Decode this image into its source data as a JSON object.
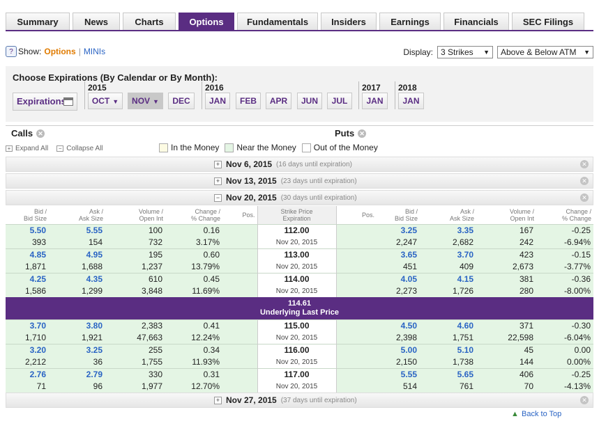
{
  "tabs": [
    {
      "label": "Summary",
      "w": 92
    },
    {
      "label": "News",
      "w": 68
    },
    {
      "label": "Charts",
      "w": 76
    },
    {
      "label": "Options",
      "w": 80,
      "active": true
    },
    {
      "label": "Fundamentals",
      "w": 116
    },
    {
      "label": "Insiders",
      "w": 80
    },
    {
      "label": "Earnings",
      "w": 88
    },
    {
      "label": "Financials",
      "w": 94
    },
    {
      "label": "SEC Filings",
      "w": 104
    }
  ],
  "show": {
    "label": "Show:",
    "selected": "Options",
    "other": "MINIs",
    "help": "?"
  },
  "display": {
    "label": "Display:",
    "strikes": "3 Strikes",
    "range": "Above & Below ATM"
  },
  "expirations": {
    "title": "Choose Expirations (By Calendar or By Month):",
    "button": "Expirations",
    "years": [
      "2015",
      "2016",
      "2017",
      "2018"
    ],
    "months_2015": [
      "OCT",
      "NOV",
      "DEC"
    ],
    "months_2016": [
      "JAN",
      "FEB",
      "APR",
      "JUN",
      "JUL"
    ],
    "months_2017": [
      "JAN"
    ],
    "months_2018": [
      "JAN"
    ]
  },
  "calls_label": "Calls",
  "puts_label": "Puts",
  "expand_all": "Expand All",
  "collapse_all": "Collapse All",
  "legend": [
    {
      "label": "In the Money",
      "color": "#fdfbe3"
    },
    {
      "label": "Near the Money",
      "color": "#e4f5e4"
    },
    {
      "label": "Out of the Money",
      "color": "#ffffff"
    }
  ],
  "expiration_bars": [
    {
      "date": "Nov 6, 2015",
      "until": "(16 days until expiration)",
      "state": "+"
    },
    {
      "date": "Nov 13, 2015",
      "until": "(23 days until expiration)",
      "state": "+"
    },
    {
      "date": "Nov 20, 2015",
      "until": "(30 days until expiration)",
      "state": "−"
    },
    {
      "date": "Nov 27, 2015",
      "until": "(37 days until expiration)",
      "state": "+"
    }
  ],
  "columns": {
    "call_bid": [
      "Bid /",
      "Bid Size"
    ],
    "call_ask": [
      "Ask /",
      "Ask Size"
    ],
    "call_vol": [
      "Volume /",
      "Open Int"
    ],
    "call_chg": [
      "Change /",
      "% Change"
    ],
    "call_pos": "Pos.",
    "strike": [
      "Strike Price",
      "Expiration"
    ],
    "put_pos": "Pos.",
    "put_bid": [
      "Bid /",
      "Bid Size"
    ],
    "put_ask": [
      "Ask /",
      "Ask Size"
    ],
    "put_vol": [
      "Volume /",
      "Open Int"
    ],
    "put_chg": [
      "Change /",
      "% Change"
    ]
  },
  "rows_above": [
    {
      "cb": "5.50",
      "cbs": "393",
      "ca": "5.55",
      "cas": "154",
      "cv": "100",
      "coi": "732",
      "cc": "0.16",
      "cpc": "3.17%",
      "strike": "112.00",
      "exp": "Nov 20, 2015",
      "pb": "3.25",
      "pbs": "2,247",
      "pa": "3.35",
      "pas": "2,682",
      "pv": "167",
      "poi": "242",
      "pc": "-0.25",
      "ppc": "-6.94%"
    },
    {
      "cb": "4.85",
      "cbs": "1,871",
      "ca": "4.95",
      "cas": "1,688",
      "cv": "195",
      "coi": "1,237",
      "cc": "0.60",
      "cpc": "13.79%",
      "strike": "113.00",
      "exp": "Nov 20, 2015",
      "pb": "3.65",
      "pbs": "451",
      "pa": "3.70",
      "pas": "409",
      "pv": "423",
      "poi": "2,673",
      "pc": "-0.15",
      "ppc": "-3.77%"
    },
    {
      "cb": "4.25",
      "cbs": "1,586",
      "ca": "4.35",
      "cas": "1,299",
      "cv": "610",
      "coi": "3,848",
      "cc": "0.45",
      "cpc": "11.69%",
      "strike": "114.00",
      "exp": "Nov 20, 2015",
      "pb": "4.05",
      "pbs": "2,273",
      "pa": "4.15",
      "pas": "1,726",
      "pv": "381",
      "poi": "280",
      "pc": "-0.36",
      "ppc": "-8.00%"
    }
  ],
  "underlying": {
    "price": "114.61",
    "label": "Underlying Last Price"
  },
  "rows_below": [
    {
      "cb": "3.70",
      "cbs": "1,710",
      "ca": "3.80",
      "cas": "1,921",
      "cv": "2,383",
      "coi": "47,663",
      "cc": "0.41",
      "cpc": "12.24%",
      "strike": "115.00",
      "exp": "Nov 20, 2015",
      "pb": "4.50",
      "pbs": "2,398",
      "pa": "4.60",
      "pas": "1,751",
      "pv": "371",
      "poi": "22,598",
      "pc": "-0.30",
      "ppc": "-6.04%"
    },
    {
      "cb": "3.20",
      "cbs": "2,212",
      "ca": "3.25",
      "cas": "36",
      "cv": "255",
      "coi": "1,755",
      "cc": "0.34",
      "cpc": "11.93%",
      "strike": "116.00",
      "exp": "Nov 20, 2015",
      "pb": "5.00",
      "pbs": "2,150",
      "pa": "5.10",
      "pas": "1,738",
      "pv": "45",
      "poi": "144",
      "pc": "0.00",
      "ppc": "0.00%"
    },
    {
      "cb": "2.76",
      "cbs": "71",
      "ca": "2.79",
      "cas": "96",
      "cv": "330",
      "coi": "1,977",
      "cc": "0.31",
      "cpc": "12.70%",
      "strike": "117.00",
      "exp": "Nov 20, 2015",
      "pb": "5.55",
      "pbs": "514",
      "pa": "5.65",
      "pas": "761",
      "pv": "406",
      "poi": "70",
      "pc": "-0.25",
      "ppc": "-4.13%"
    }
  ],
  "back_to_top": "Back to Top"
}
